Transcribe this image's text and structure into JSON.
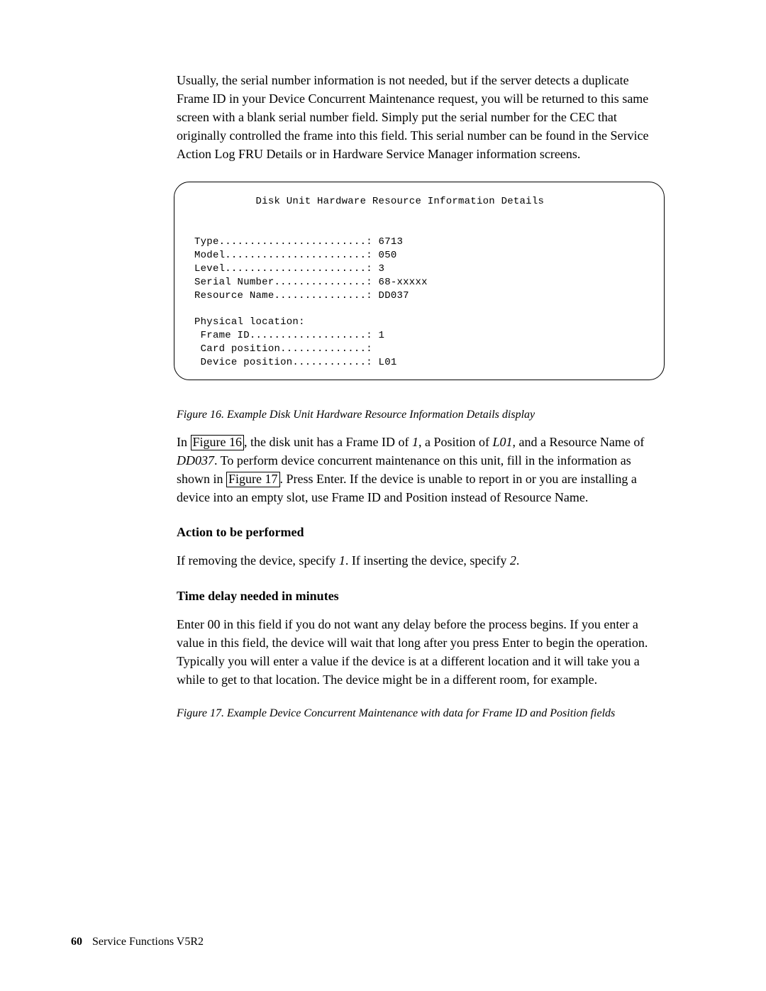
{
  "intro_para": "Usually, the serial number information is not needed, but if the server detects a duplicate Frame ID in your Device Concurrent Maintenance request, you will be returned to this same screen with a blank serial number field. Simply put the serial number for the CEC that originally controlled the frame into this field. This serial number can be found in the Service Action Log FRU Details or in Hardware Service Manager information screens.",
  "terminal_block": "          Disk Unit Hardware Resource Information Details\n\n\nType........................: 6713\nModel.......................: 050\nLevel.......................: 3\nSerial Number...............: 68-xxxxx\nResource Name...............: DD037\n\nPhysical location:\n Frame ID...................: 1\n Card position..............:\n Device position............: L01\n",
  "fig16_caption": "Figure 16. Example Disk Unit Hardware Resource Information Details display",
  "para2_pre": "In ",
  "ref_fig16": "Figure 16",
  "para2_mid1": ", the disk unit has a Frame ID of ",
  "para2_em1": "1",
  "para2_mid2": ", a Position of ",
  "para2_em2": "L01",
  "para2_mid3": ", and a Resource Name of ",
  "para2_em3": "DD037",
  "para2_mid4": ". To perform device concurrent maintenance on this unit, fill in the information as shown in ",
  "ref_fig17": "Figure 17",
  "para2_tail": ". Press Enter. If the device is unable to report in or you are installing a device into an empty slot, use Frame ID and Position instead of Resource Name.",
  "heading_action": "Action to be performed",
  "action_sentence_pre": "If removing the device, specify ",
  "action_em1": "1",
  "action_mid": ". If inserting the device, specify ",
  "action_em2": "2",
  "action_tail": ".",
  "heading_time": "Time delay needed in minutes",
  "time_para": "Enter 00 in this field if you do not want any delay before the process begins. If you enter a value in this field, the device will wait that long after you press Enter to begin the operation. Typically you will enter a value if the device is at a different location and it will take you a while to get to that location. The device might be in a different room, for example.",
  "fig17_caption": "Figure 17. Example Device Concurrent Maintenance with data for Frame ID and Position fields",
  "page_number": "60",
  "footer_text": "Service Functions V5R2"
}
